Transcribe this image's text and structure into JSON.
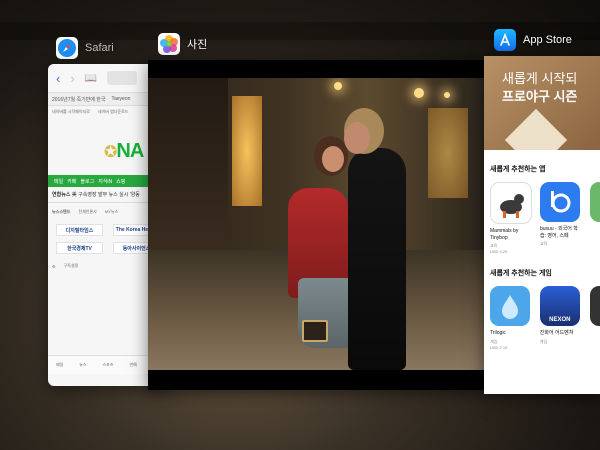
{
  "switcher": {
    "apps": [
      {
        "name": "Safari",
        "icon": "safari-compass-icon"
      },
      {
        "name": "사진",
        "icon": "photos-flower-icon"
      },
      {
        "name": "App Store",
        "icon": "app-store-icon"
      }
    ]
  },
  "safari": {
    "tabs": [
      "2016년7월 즉기반에 한국",
      "Taeyeon"
    ],
    "bookmarks": [
      "네이버를 시작페이지로",
      "네이버 앱다운로드"
    ],
    "logo": "NA",
    "nav_items": [
      "메일",
      "카페",
      "블로그",
      "지식iN",
      "쇼핑"
    ],
    "news_header": "연합뉴스",
    "news_line": "美 구속영장 발부 뉴스 실시 '양동",
    "news_tabs": [
      "뉴스스탠드",
      "전체언론사",
      "MY뉴스"
    ],
    "press": [
      "디지털타임스",
      "The Korea Herald",
      "한국경제TV",
      "동아사이언스"
    ],
    "subscribe": "구독설정",
    "footer_items": [
      "메일",
      "뉴스",
      "스포츠",
      "연예",
      "웹툰"
    ]
  },
  "photos": {
    "description_colors": {
      "coat": "#b42a2a",
      "dress": "#6f7a7d",
      "street": "#6d5b44"
    }
  },
  "store": {
    "banner_line1": "새롭게 시작되",
    "banner_line2": "프로야구 시즌",
    "section1_title": "새롭게 추천하는 앱",
    "apps1": [
      {
        "name": "Mammals by Tinybop",
        "category": "교육",
        "price": "USD 3.29"
      },
      {
        "name": "busuu - 외국어 학습: 영어, 스페",
        "category": "교육",
        "price": ""
      }
    ],
    "section2_title": "새롭게 추천하는 게임",
    "apps2": [
      {
        "name": "Trilogic",
        "category": "게임",
        "price": "USD 2.19"
      },
      {
        "name": "진화어 어드벤쳐",
        "category": "게임",
        "price": ""
      }
    ],
    "nexon_label": "NEXON"
  }
}
